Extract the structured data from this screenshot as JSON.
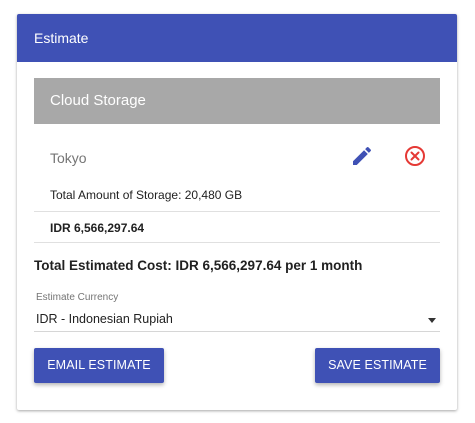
{
  "card": {
    "title": "Estimate"
  },
  "section": {
    "title": "Cloud Storage"
  },
  "item": {
    "region": "Tokyo",
    "edit_icon": "pencil-icon",
    "remove_icon": "circle-x-icon",
    "storage_text": "Total Amount of Storage: 20,480 GB",
    "cost": "IDR 6,566,297.64"
  },
  "total": {
    "text": "Total Estimated Cost: IDR 6,566,297.64 per 1 month"
  },
  "currency": {
    "label": "Estimate Currency",
    "value": "IDR - Indonesian Rupiah"
  },
  "actions": {
    "email_label": "EMAIL ESTIMATE",
    "save_label": "SAVE ESTIMATE"
  },
  "colors": {
    "primary": "#3f51b5",
    "section_header": "#a8a8a8",
    "remove": "#e53935"
  }
}
